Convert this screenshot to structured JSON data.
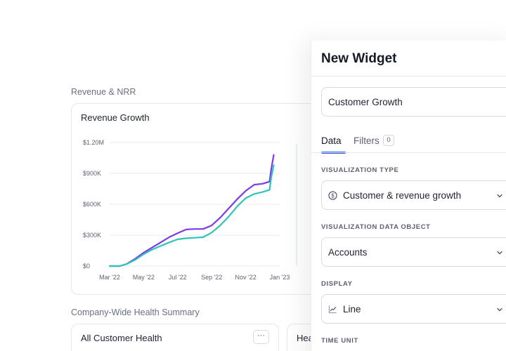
{
  "dashboard": {
    "revenue_section_label": "Revenue & NRR",
    "revenue_card_title": "Revenue Growth",
    "health_section_label": "Company-Wide Health Summary",
    "health_card_title": "All Customer Health",
    "health_card_2_title": "Heal",
    "more_button_label": "···"
  },
  "chart_data": {
    "type": "line",
    "title": "Revenue Growth",
    "xlabel": "",
    "ylabel": "",
    "categories": [
      "Mar '22",
      "May '22",
      "Jul '22",
      "Sep '22",
      "Nov '22",
      "Jan '23"
    ],
    "yticks": [
      "$0",
      "$300K",
      "$600K",
      "$900K",
      "$1.20M"
    ],
    "ylim": [
      0,
      1200000
    ],
    "x_range": [
      0,
      10
    ],
    "grid": true,
    "series": [
      {
        "color": "#7c3aed",
        "x": [
          0,
          0.6,
          1,
          1.5,
          2,
          2.5,
          3,
          3.5,
          4,
          4.5,
          5,
          5.5,
          6,
          6.5,
          7,
          7.5,
          8,
          8.5,
          9,
          9.4,
          9.5,
          9.65
        ],
        "y": [
          0,
          0,
          20000,
          70000,
          130000,
          180000,
          230000,
          280000,
          320000,
          355000,
          360000,
          360000,
          395000,
          470000,
          560000,
          650000,
          730000,
          790000,
          800000,
          820000,
          940000,
          1080000
        ]
      },
      {
        "color": "#2ec4b6",
        "x": [
          0,
          0.6,
          1,
          1.5,
          2,
          2.5,
          3,
          3.5,
          4,
          4.5,
          5,
          5.5,
          6,
          6.5,
          7,
          7.5,
          8,
          8.5,
          9,
          9.4,
          9.5,
          9.65
        ],
        "y": [
          0,
          0,
          20000,
          60000,
          115000,
          160000,
          195000,
          230000,
          260000,
          270000,
          275000,
          280000,
          325000,
          395000,
          480000,
          580000,
          660000,
          700000,
          720000,
          740000,
          860000,
          980000
        ]
      }
    ]
  },
  "panel": {
    "title": "New Widget",
    "name_value": "Customer Growth",
    "tabs": [
      {
        "label": "Data",
        "active": true
      },
      {
        "label": "Filters",
        "count": "0"
      }
    ],
    "fields": {
      "viz_type": {
        "label": "VISUALIZATION TYPE",
        "value": "Customer & revenue growth",
        "icon": "dollar-circle-icon"
      },
      "viz_object": {
        "label": "VISUALIZATION DATA OBJECT",
        "value": "Accounts"
      },
      "display": {
        "label": "DISPLAY",
        "value": "Line",
        "icon": "line-chart-icon"
      },
      "time_unit": {
        "label": "TIME UNIT"
      }
    },
    "accent_color": "#2a5bd7"
  }
}
